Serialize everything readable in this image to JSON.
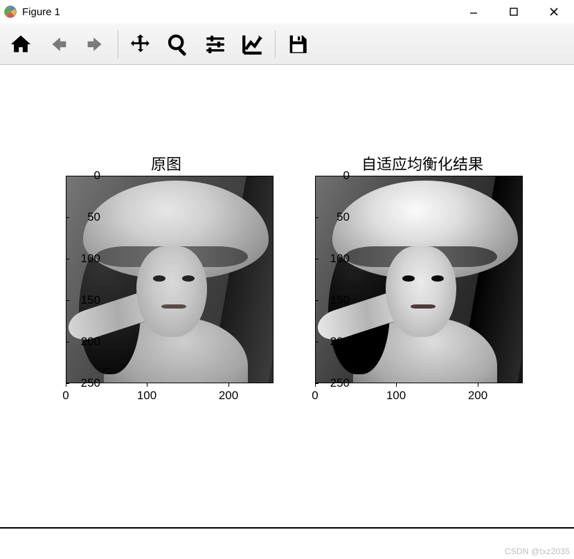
{
  "window": {
    "title": "Figure 1",
    "buttons": {
      "minimize": "Minimize",
      "maximize": "Maximize",
      "close": "Close"
    }
  },
  "toolbar": {
    "home": "Home",
    "back": "Back",
    "forward": "Forward",
    "pan": "Pan",
    "zoom": "Zoom",
    "configure": "Configure subplots",
    "axes": "Edit axes",
    "save": "Save"
  },
  "subplots": [
    {
      "title": "原图",
      "yticks": [
        "0",
        "50",
        "100",
        "150",
        "200",
        "250"
      ],
      "xticks": [
        "0",
        "100",
        "200"
      ]
    },
    {
      "title": "自适应均衡化结果",
      "yticks": [
        "0",
        "50",
        "100",
        "150",
        "200",
        "250"
      ],
      "xticks": [
        "0",
        "100",
        "200"
      ]
    }
  ],
  "watermark": "CSDN @txz2035",
  "chart_data": [
    {
      "type": "heatmap",
      "title": "原图",
      "description": "Grayscale portrait image (original). Axes display pixel indices.",
      "xlabel": "",
      "ylabel": "",
      "xlim": [
        0,
        255
      ],
      "ylim": [
        255,
        0
      ],
      "xticks": [
        0,
        100,
        200
      ],
      "yticks": [
        0,
        50,
        100,
        150,
        200,
        250
      ]
    },
    {
      "type": "heatmap",
      "title": "自适应均衡化结果",
      "description": "Same grayscale portrait after adaptive histogram equalization (CLAHE) — higher local contrast than left panel.",
      "xlabel": "",
      "ylabel": "",
      "xlim": [
        0,
        255
      ],
      "ylim": [
        255,
        0
      ],
      "xticks": [
        0,
        100,
        200
      ],
      "yticks": [
        0,
        50,
        100,
        150,
        200,
        250
      ]
    }
  ]
}
